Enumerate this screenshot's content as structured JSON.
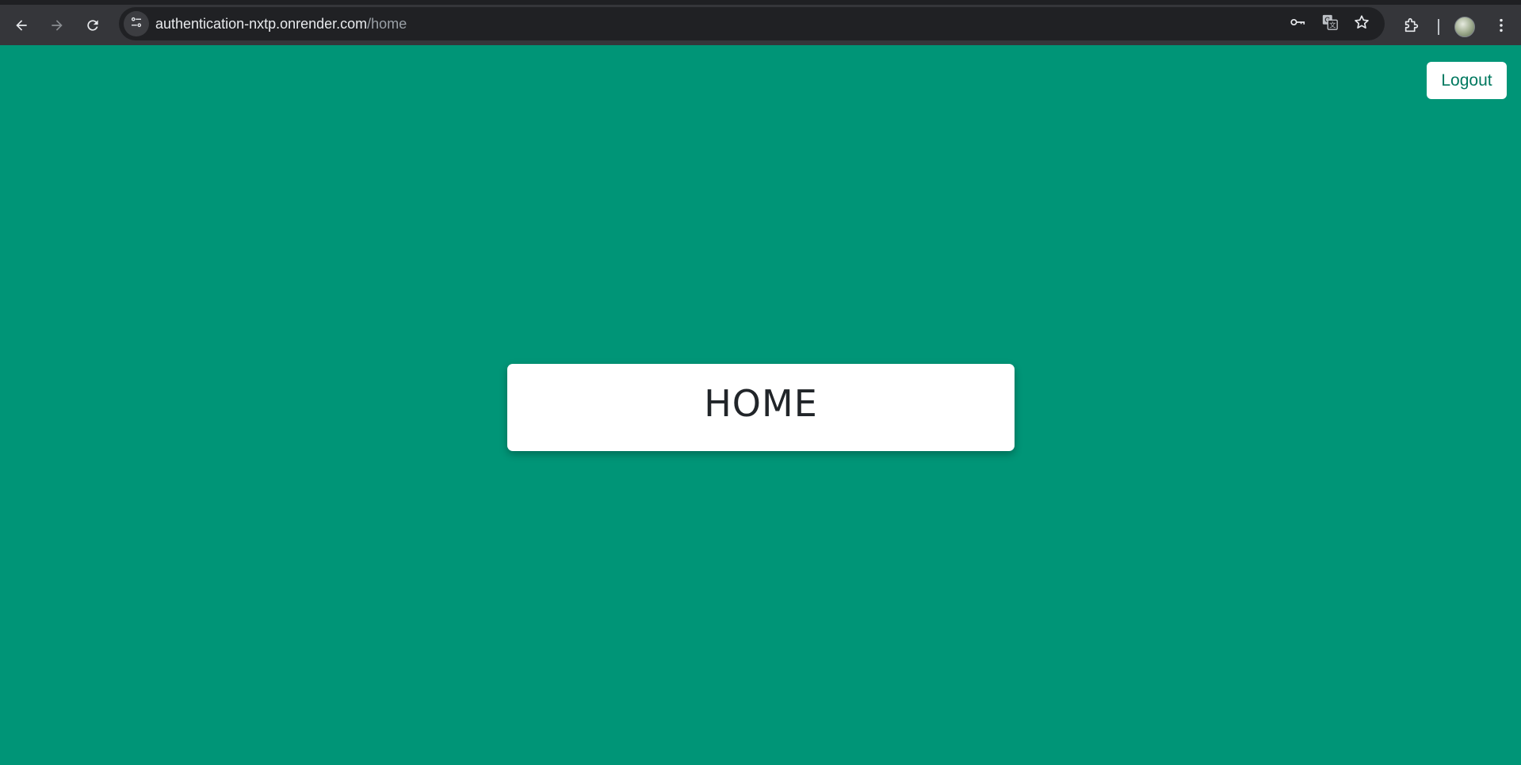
{
  "browser": {
    "url_host": "authentication-nxtp.onrender.com",
    "url_path": "/home",
    "toolbar_icons": [
      "back-icon",
      "forward-icon",
      "reload-icon",
      "site-info-icon",
      "key-icon",
      "translate-icon",
      "star-icon",
      "extensions-icon",
      "profile-avatar",
      "menu-icon"
    ]
  },
  "page": {
    "logout_label": "Logout",
    "heading": "HOME"
  },
  "colors": {
    "background": "#009577",
    "card": "#ffffff",
    "logout_text": "#00785f",
    "heading_text": "#212529",
    "chrome_toolbar": "#35363a",
    "omnibox": "#202124"
  }
}
